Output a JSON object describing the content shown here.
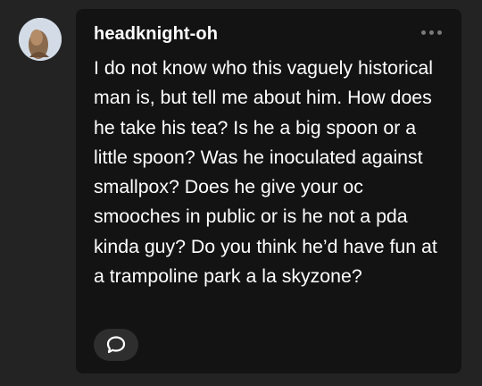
{
  "post": {
    "username": "headknight-oh",
    "text": "I do not know who this vaguely historical man is, but tell me about him. How does he take his tea? Is he a big spoon or a little spoon? Was he inoculated against smallpox? Does he give your oc smooches in public or is he not a pda kinda guy? Do you think he’d have fun at a trampoline park a la skyzone?"
  },
  "icons": {
    "avatar": "avatar",
    "more": "more-options-icon",
    "reply": "reply-bubble-icon"
  },
  "colors": {
    "background": "#232323",
    "card": "#131313",
    "text": "#ffffff",
    "muted": "#7a7a7a",
    "button": "#2e2e2e"
  }
}
